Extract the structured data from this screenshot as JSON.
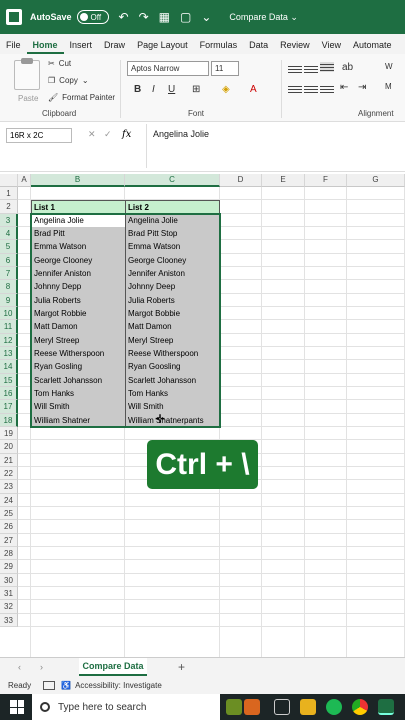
{
  "titlebar": {
    "autosave_label": "AutoSave",
    "autosave_state": "Off",
    "doc_title": "Compare Data ⌄"
  },
  "ribbon_tabs": [
    "File",
    "Home",
    "Insert",
    "Draw",
    "Page Layout",
    "Formulas",
    "Data",
    "Review",
    "View",
    "Automate"
  ],
  "ribbon": {
    "paste": "Paste",
    "cut": "Cut",
    "copy": "Copy",
    "format_painter": "Format Painter",
    "clipboard": "Clipboard",
    "font_name": "Aptos Narrow",
    "font_size": "11",
    "font_group": "Font",
    "alignment_group": "Alignment",
    "bold": "B",
    "italic": "I",
    "underline": "U",
    "wrap_partial": "W",
    "merge_partial": "M"
  },
  "formula_bar": {
    "name_box": "16R x 2C",
    "fx": "fx",
    "content": "Angelina Jolie"
  },
  "columns": [
    "A",
    "B",
    "C",
    "D",
    "E",
    "F",
    "G"
  ],
  "rows": [
    "1",
    "2",
    "3",
    "4",
    "5",
    "6",
    "7",
    "8",
    "9",
    "10",
    "11",
    "12",
    "13",
    "14",
    "15",
    "16",
    "17",
    "18",
    "19",
    "20",
    "21",
    "22",
    "23",
    "24",
    "25",
    "26",
    "27",
    "28",
    "29",
    "30",
    "31",
    "32",
    "33"
  ],
  "table": {
    "headers": [
      "List 1",
      "List 2"
    ],
    "rows": [
      [
        "Angelina Jolie",
        "Angelina Jolie"
      ],
      [
        "Brad Pitt",
        "Brad Pitt Stop"
      ],
      [
        "Emma Watson",
        "Emma Watson"
      ],
      [
        "George Clooney",
        "George Clooney"
      ],
      [
        "Jennifer Aniston",
        "Jennifer Aniston"
      ],
      [
        "Johnny Depp",
        "Johnny Deep"
      ],
      [
        "Julia Roberts",
        "Julia Roberts"
      ],
      [
        "Margot Robbie",
        "Margot Bobbie"
      ],
      [
        "Matt Damon",
        "Matt Damon"
      ],
      [
        "Meryl Streep",
        "Meryl Streep"
      ],
      [
        "Reese Witherspoon",
        "Reese Witherspoon"
      ],
      [
        "Ryan Gosling",
        "Ryan Goosling"
      ],
      [
        "Scarlett Johansson",
        "Scarlett Johansson"
      ],
      [
        "Tom Hanks",
        "Tom Hanks"
      ],
      [
        "Will Smith",
        "Will Smith"
      ],
      [
        "William Shatner",
        "William Shatnerpants"
      ]
    ]
  },
  "shortcut_badge": "Ctrl + \\",
  "sheet": {
    "tab": "Compare Data",
    "add": "+"
  },
  "status": {
    "ready": "Ready",
    "accessibility": "Accessibility: Investigate"
  },
  "taskbar": {
    "search_placeholder": "Type here to search"
  },
  "colors": {
    "excel_green": "#1e6e42",
    "header_fill": "#c6efce",
    "gray_fill": "#c9c9c9",
    "badge": "#1d7a2f"
  }
}
